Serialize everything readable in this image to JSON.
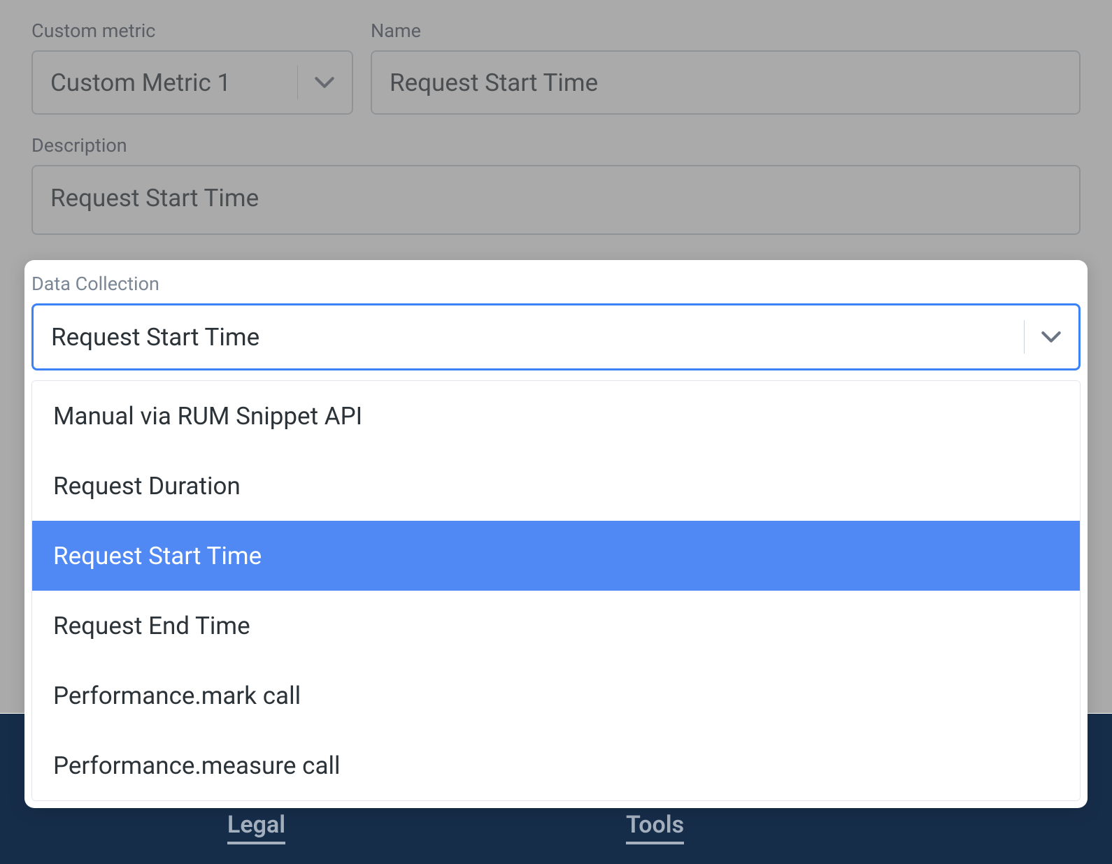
{
  "form": {
    "custom_metric": {
      "label": "Custom metric",
      "value": "Custom Metric 1"
    },
    "name": {
      "label": "Name",
      "value": "Request Start Time"
    },
    "description": {
      "label": "Description",
      "value": "Request Start Time"
    },
    "data_collection": {
      "label": "Data Collection",
      "value": "Request Start Time",
      "options": [
        "Manual via RUM Snippet API",
        "Request Duration",
        "Request Start Time",
        "Request End Time",
        "Performance.mark call",
        "Performance.measure call"
      ],
      "selected_index": 2
    }
  },
  "footer": {
    "legal": "Legal",
    "tools": "Tools"
  }
}
